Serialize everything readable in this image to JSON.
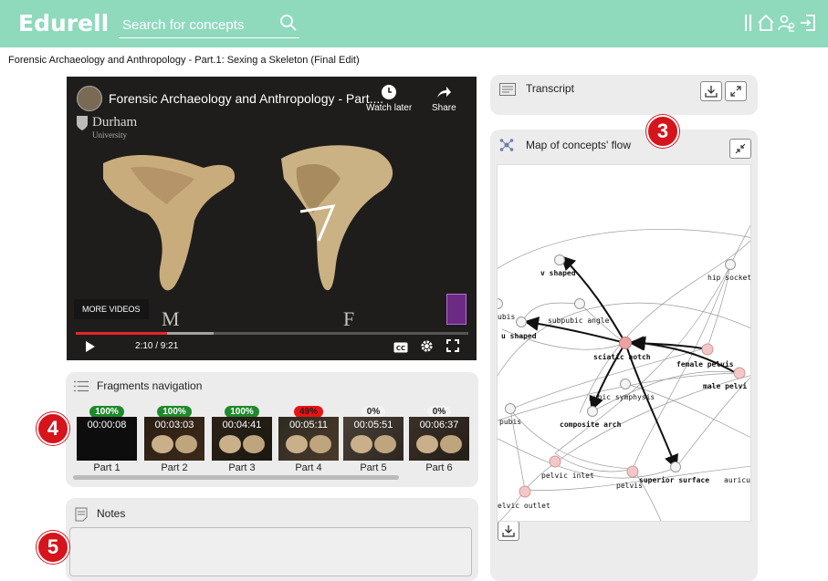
{
  "app": {
    "logo": "Edurell"
  },
  "search": {
    "placeholder": "Search for concepts"
  },
  "top_icons": [
    "separator-bars-icon",
    "home-icon",
    "users-icon",
    "logout-icon"
  ],
  "page": {
    "title": "Forensic Archaeology and Anthropology - Part.1: Sexing a Skeleton (Final Edit)"
  },
  "video": {
    "title": "Forensic Archaeology and Anthropology - Part....",
    "watch_later": "Watch later",
    "share": "Share",
    "logo_name": "Durham",
    "logo_sub": "University",
    "more_videos": "MORE VIDEOS",
    "label_left": "M",
    "label_right": "F",
    "time": "2:10 / 9:21",
    "progress": 0.232,
    "buffered": 0.35
  },
  "transcript": {
    "label": "Transcript"
  },
  "fragments": {
    "label": "Fragments navigation",
    "items": [
      {
        "pct": "100%",
        "time": "00:00:08",
        "part": "Part 1"
      },
      {
        "pct": "100%",
        "time": "00:03:03",
        "part": "Part 2"
      },
      {
        "pct": "100%",
        "time": "00:04:41",
        "part": "Part 3"
      },
      {
        "pct": "49%",
        "time": "00:05:11",
        "part": "Part 4"
      },
      {
        "pct": "0%",
        "time": "00:05:51",
        "part": "Part 5"
      },
      {
        "pct": "0%",
        "time": "00:06:37",
        "part": "Part 6"
      }
    ]
  },
  "notes": {
    "label": "Notes"
  },
  "concept_map": {
    "label": "Map of concepts' flow",
    "nodes": [
      {
        "id": "v_shaped",
        "label": "v shaped",
        "bold": true
      },
      {
        "id": "hip_socket",
        "label": "hip socket",
        "bold": false
      },
      {
        "id": "pubis_top",
        "label": "ubis",
        "bold": false
      },
      {
        "id": "subpubic_angle",
        "label": "subpubic angle",
        "bold": false
      },
      {
        "id": "u_shaped",
        "label": "u shaped",
        "bold": true
      },
      {
        "id": "sciatic_notch",
        "label": "sciatic notch",
        "bold": true
      },
      {
        "id": "female_pelvis",
        "label": "female pelvis",
        "bold": true
      },
      {
        "id": "male_pelvis",
        "label": "male pelvi",
        "bold": true
      },
      {
        "id": "pubic_symphysis",
        "label": "pubic symphysis",
        "bold": false
      },
      {
        "id": "pubis",
        "label": "pubis",
        "bold": false
      },
      {
        "id": "composite_arch",
        "label": "composite arch",
        "bold": true
      },
      {
        "id": "pelvic_inlet",
        "label": "pelvic inlet",
        "bold": false
      },
      {
        "id": "pelvis",
        "label": "pelvis",
        "bold": false
      },
      {
        "id": "superior_surface",
        "label": "superior surface",
        "bold": true
      },
      {
        "id": "auricular",
        "label": "auricu",
        "bold": false
      },
      {
        "id": "pelvic_outlet",
        "label": "elvic outlet",
        "bold": false
      }
    ]
  },
  "callouts": [
    "3",
    "4",
    "5"
  ],
  "colors": {
    "header": "#8fd9bd",
    "panel": "#ececec",
    "complete": "#1e8a2c",
    "partial": "#e11111",
    "callout": "#d6141c"
  }
}
